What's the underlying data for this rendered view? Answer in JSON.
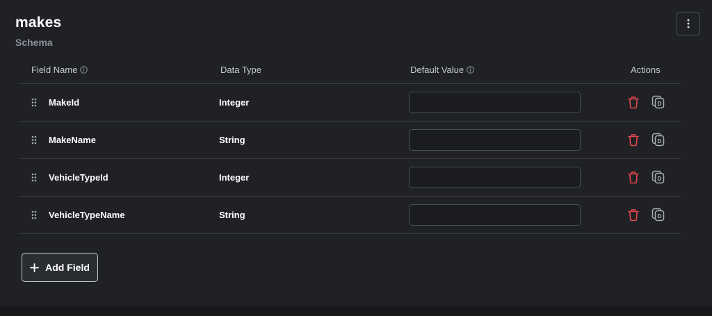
{
  "header": {
    "title": "makes",
    "subtitle": "Schema",
    "menu_icon": "kebab-vertical-icon"
  },
  "table": {
    "columns": {
      "field_name": "Field Name",
      "data_type": "Data Type",
      "default_value": "Default Value",
      "actions": "Actions"
    },
    "rows": [
      {
        "field_name": "MakeId",
        "data_type": "Integer",
        "default_value": ""
      },
      {
        "field_name": "MakeName",
        "data_type": "String",
        "default_value": ""
      },
      {
        "field_name": "VehicleTypeId",
        "data_type": "Integer",
        "default_value": ""
      },
      {
        "field_name": "VehicleTypeName",
        "data_type": "String",
        "default_value": ""
      }
    ]
  },
  "add_field": {
    "label": "Add Field",
    "icon": "plus-icon"
  },
  "colors": {
    "delete": "#e5484d",
    "duplicate": "#a9adb4",
    "text_primary": "#ffffff",
    "text_muted": "#8b9099"
  }
}
